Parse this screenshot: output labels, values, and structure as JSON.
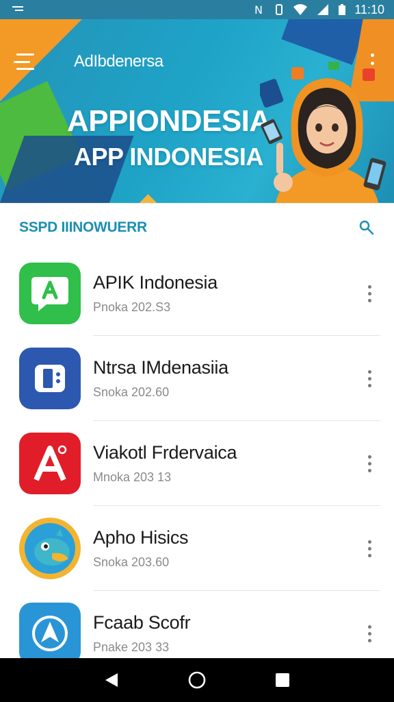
{
  "status_bar": {
    "time": "11:10",
    "icons": [
      "menu-lines-icon",
      "nfc-icon",
      "vibrate-icon",
      "wifi-icon",
      "signal-icon",
      "battery-icon"
    ]
  },
  "header": {
    "brand": "AdIbdenersa",
    "hero_title": "APPIONDESIA",
    "hero_subtitle": "APP INDONESIA",
    "colors": {
      "banner": "#1ea3c7",
      "accent_orange": "#f29a25",
      "accent_green": "#4dbb3f"
    }
  },
  "section": {
    "title": "SSPD IIINOWUERR"
  },
  "apps": [
    {
      "name": "APIK Indonesia",
      "meta": "Pnoka 202.S3",
      "icon": "chat-bubble-icon",
      "color": "#2fbf4a"
    },
    {
      "name": "Ntrsa IMdenasiia",
      "meta": "Snoka 202.60",
      "icon": "camera-app-icon",
      "color": "#2c58b0"
    },
    {
      "name": "Viakotl Frdervaica",
      "meta": "Mnoka 203 13",
      "icon": "letter-a-icon",
      "color": "#e11d2a"
    },
    {
      "name": "Apho Hisics",
      "meta": "Snoka 203.60",
      "icon": "bird-icon",
      "color": "#2a9fd8"
    },
    {
      "name": "Fcaab Scofr",
      "meta": "Pnake 203 33",
      "icon": "navigation-a-icon",
      "color": "#2a95d6"
    }
  ],
  "nav": {
    "buttons": [
      "back-icon",
      "home-icon",
      "recents-icon"
    ]
  }
}
